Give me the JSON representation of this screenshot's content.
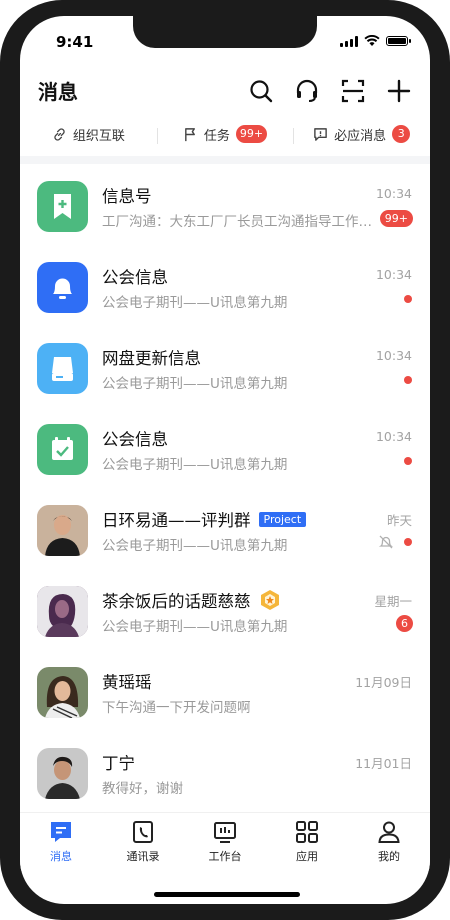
{
  "status": {
    "time": "9:41"
  },
  "header": {
    "title": "消息"
  },
  "quick": [
    {
      "label": "组织互联",
      "badge": ""
    },
    {
      "label": "任务",
      "badge": "99+"
    },
    {
      "label": "必应消息",
      "badge": "3"
    }
  ],
  "conversations": [
    {
      "name": "信息号",
      "preview": "工厂沟通：大东工厂厂长员工沟通指导工作…",
      "time": "10:34",
      "badge": "99+",
      "avatar_color": "#4cba7f",
      "icon": "bookmark-plus-icon"
    },
    {
      "name": "公会信息",
      "preview": "公会电子期刊——U讯息第九期",
      "time": "10:34",
      "avatar_color": "#2f6ef5",
      "icon": "bell-icon"
    },
    {
      "name": "网盘更新信息",
      "preview": "公会电子期刊——U讯息第九期",
      "time": "10:34",
      "avatar_color": "#4db1f5",
      "icon": "drive-icon"
    },
    {
      "name": "公会信息",
      "preview": "公会电子期刊——U讯息第九期",
      "time": "10:34",
      "avatar_color": "#4cba7f",
      "icon": "calendar-check-icon"
    },
    {
      "name": "日环易通——评判群",
      "tag": "Project",
      "preview": "公会电子期刊——U讯息第九期",
      "time": "昨天",
      "muted": true,
      "avatar_color": "#6b5246"
    },
    {
      "name": "茶余饭后的话题慈慈",
      "preview": "公会电子期刊——U讯息第九期",
      "time": "星期一",
      "badge": "6",
      "avatar_color": "#5a3a5c"
    },
    {
      "name": "黄瑶瑶",
      "preview": "下午沟通一下开发问题啊",
      "time": "11月09日",
      "avatar_color": "#4a4038"
    },
    {
      "name": "丁宁",
      "preview": "教得好，谢谢",
      "time": "11月01日",
      "avatar_color": "#3e4a52"
    }
  ],
  "tabs": [
    {
      "label": "消息",
      "icon": "message-icon",
      "active": true
    },
    {
      "label": "通讯录",
      "icon": "contacts-icon"
    },
    {
      "label": "工作台",
      "icon": "workbench-icon"
    },
    {
      "label": "应用",
      "icon": "apps-icon"
    },
    {
      "label": "我的",
      "icon": "profile-icon"
    }
  ],
  "colors": {
    "accent": "#2f6ef5",
    "alert": "#ec4b43"
  }
}
